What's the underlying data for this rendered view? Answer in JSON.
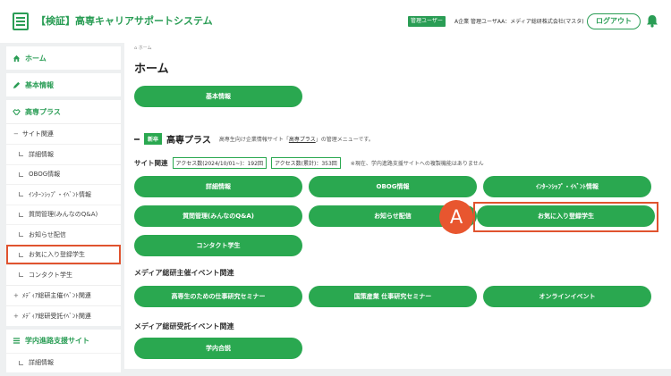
{
  "header": {
    "title": "【検証】高専キャリアサポートシステム",
    "admin_badge": "管理ユーザー",
    "user_info": "A企業 管理ユーザAA：メディア総研株式会社(マスタ)",
    "logout": "ログアウト"
  },
  "sidebar": {
    "home": "ホーム",
    "basic": "基本情報",
    "kosen_plus": "高専プラス",
    "site_group": "サイト関連",
    "items": [
      "詳細情報",
      "OBOG情報",
      "ｲﾝﾀｰﾝｼｯﾌﾟ・ｲﾍﾞﾝﾄ情報",
      "質問管理(みんなのQ&A)",
      "お知らせ配信",
      "お気に入り登録学生",
      "コンタクト学生"
    ],
    "event_group1": "ﾒﾃﾞｨｱ総研主催ｲﾍﾞﾝﾄ関連",
    "event_group2": "ﾒﾃﾞｨｱ総研受託ｲﾍﾞﾝﾄ関連",
    "campus": "学内進路支援サイト",
    "campus_partial": "詳細情報"
  },
  "main": {
    "breadcrumb": "ホーム",
    "title": "ホーム",
    "basic_btn": "基本情報",
    "new_tag": "新卒",
    "section_title": "高専プラス",
    "section_desc_pre": "高専生向け企業情報サイト「",
    "section_desc_link": "高専プラス",
    "section_desc_post": "」の管理メニューです。",
    "site_label": "サイト関連",
    "access_period": "アクセス数(2024/10/01~)：192回",
    "access_total": "アクセス数(累計)：353回",
    "note": "※現在、学内進路支援サイトへの複製機能はありません",
    "site_buttons": [
      "詳細情報",
      "OBOG情報",
      "ｲﾝﾀｰﾝｼｯﾌﾟ・ｲﾍﾞﾝﾄ情報",
      "質問管理(みんなのQ&A)",
      "お知らせ配信",
      "お気に入り登録学生",
      "コンタクト学生"
    ],
    "event1_title": "メディア総研主催イベント関連",
    "event1_buttons": [
      "高専生のための仕事研究セミナー",
      "国策産業 仕事研究セミナー",
      "オンラインイベント"
    ],
    "event2_title": "メディア総研受託イベント関連",
    "event2_buttons": [
      "学内合説"
    ],
    "marker": "A"
  },
  "colors": {
    "accent": "#2aa850",
    "highlight": "#e0532f"
  }
}
